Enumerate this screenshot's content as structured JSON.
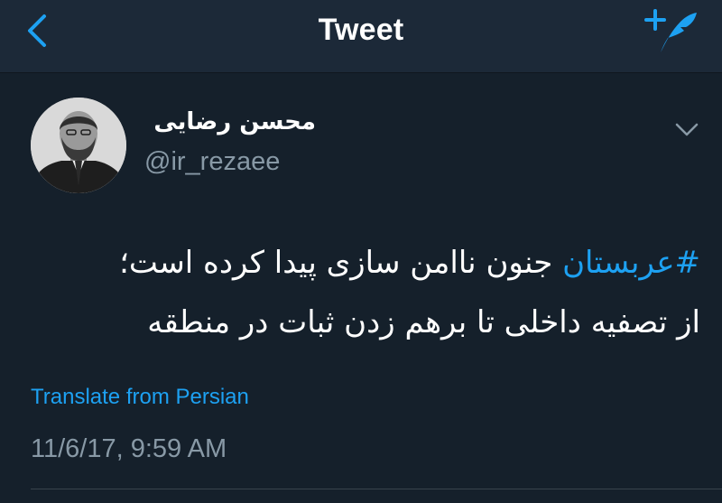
{
  "navbar": {
    "title": "Tweet",
    "back_icon": "chevron-left-icon",
    "compose_icon": "compose-tweet-icon"
  },
  "tweet": {
    "author": {
      "display_name": "محسن رضایی",
      "handle": "@ir_rezaee",
      "avatar_icon": "profile-photo"
    },
    "menu_icon": "chevron-down-icon",
    "text": {
      "hashtag": "#عربستان",
      "line1_rest": " جنون ناامن سازی پیدا کرده است؛",
      "line2": "از تصفیه داخلی تا برهم زدن ثبات در منطقه"
    },
    "translate_label": "Translate from Persian",
    "timestamp": "11/6/17, 9:59 AM"
  },
  "colors": {
    "background": "#15202b",
    "navbar": "#1c2938",
    "accent": "#1da1f2",
    "secondary_text": "#8899a6",
    "primary_text": "#ffffff"
  }
}
